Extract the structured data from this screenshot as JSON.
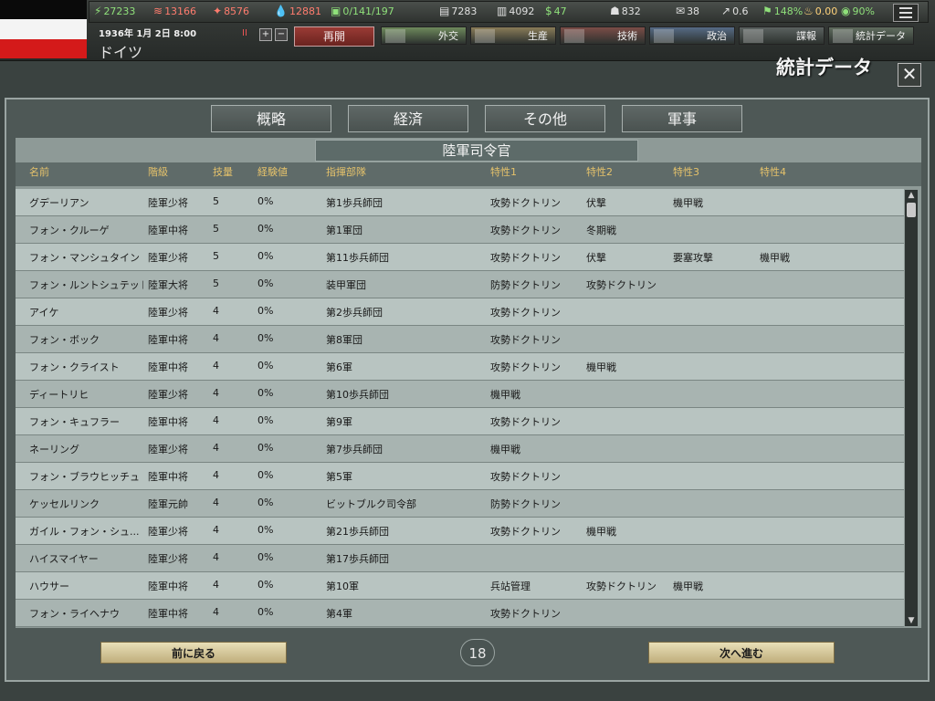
{
  "country": {
    "name": "ドイツ",
    "date": "1936年 1月 2日 8:00"
  },
  "resources": [
    {
      "icon": "energy-icon",
      "glyph": "⚡",
      "value": "27233",
      "color": "#8fe07a"
    },
    {
      "icon": "metal-icon",
      "glyph": "≋",
      "value": "13166",
      "color": "#ff7c6e"
    },
    {
      "icon": "rare-materials-icon",
      "glyph": "✦",
      "value": "8576",
      "color": "#ff7c6e"
    },
    {
      "icon": "oil-icon",
      "glyph": "💧",
      "value": "12881",
      "color": "#ff7c6e"
    },
    {
      "icon": "manpower-icon",
      "glyph": "▣",
      "value": "0/141/197",
      "color": "#8fe07a"
    },
    {
      "icon": "supplies-icon",
      "glyph": "▤",
      "value": "7283",
      "color": "#e0e0e0"
    },
    {
      "icon": "money-icon",
      "glyph": "▥",
      "value": "4092",
      "color": "#e0e0e0"
    },
    {
      "icon": "dollar-icon",
      "glyph": "$",
      "value": "47",
      "color": "#8fe07a"
    },
    {
      "icon": "soldier-icon",
      "glyph": "☗",
      "value": "832",
      "color": "#e0e0e0"
    },
    {
      "icon": "mail-icon",
      "glyph": "✉",
      "value": "38",
      "color": "#e0e0e0"
    },
    {
      "icon": "dissent-icon",
      "glyph": "↗",
      "value": "0.6",
      "color": "#e0e0e0"
    },
    {
      "icon": "national-unity-icon",
      "glyph": "⚑",
      "value": "148%",
      "color": "#8fe07a"
    },
    {
      "icon": "fuel-icon",
      "glyph": "♨",
      "value": "0.00",
      "color": "#ffd27a"
    },
    {
      "icon": "neutrality-icon",
      "glyph": "◉",
      "value": "90%",
      "color": "#8fe07a"
    }
  ],
  "controls": {
    "pause": "II",
    "plus": "+",
    "minus": "−",
    "resume": "再開"
  },
  "nav_tabs": [
    {
      "label": "外交",
      "color": "#6e8a5c"
    },
    {
      "label": "生産",
      "color": "#8a7c58"
    },
    {
      "label": "技術",
      "color": "#7b4d47"
    },
    {
      "label": "政治",
      "color": "#566b86"
    },
    {
      "label": "諜報",
      "color": "#5b6260"
    },
    {
      "label": "統計データ",
      "color": "#5f6c5e"
    }
  ],
  "panel_title": "統計データ",
  "close": "✕",
  "categories": [
    "概略",
    "経済",
    "その他",
    "軍事"
  ],
  "subtitle": "陸軍司令官",
  "columns": [
    "名前",
    "階級",
    "技量",
    "経験値",
    "指揮部隊",
    "特性1",
    "特性2",
    "特性3",
    "特性4"
  ],
  "rows": [
    [
      "グデーリアン",
      "陸軍少将",
      "5",
      "0%",
      "第1歩兵師団",
      "攻勢ドクトリン",
      "伏撃",
      "機甲戦",
      ""
    ],
    [
      "フォン・クルーゲ",
      "陸軍中将",
      "5",
      "0%",
      "第1軍団",
      "攻勢ドクトリン",
      "冬期戦",
      "",
      ""
    ],
    [
      "フォン・マンシュタイン",
      "陸軍少将",
      "5",
      "0%",
      "第11歩兵師団",
      "攻勢ドクトリン",
      "伏撃",
      "要塞攻撃",
      "機甲戦"
    ],
    [
      "フォン・ルントシュテット",
      "陸軍大将",
      "5",
      "0%",
      "装甲軍団",
      "防勢ドクトリン",
      "攻勢ドクトリン",
      "",
      ""
    ],
    [
      "アイケ",
      "陸軍少将",
      "4",
      "0%",
      "第2歩兵師団",
      "攻勢ドクトリン",
      "",
      "",
      ""
    ],
    [
      "フォン・ボック",
      "陸軍中将",
      "4",
      "0%",
      "第8軍団",
      "攻勢ドクトリン",
      "",
      "",
      ""
    ],
    [
      "フォン・クライスト",
      "陸軍中将",
      "4",
      "0%",
      "第6軍",
      "攻勢ドクトリン",
      "機甲戦",
      "",
      ""
    ],
    [
      "ディートリヒ",
      "陸軍少将",
      "4",
      "0%",
      "第10歩兵師団",
      "機甲戦",
      "",
      "",
      ""
    ],
    [
      "フォン・キュフラー",
      "陸軍中将",
      "4",
      "0%",
      "第9軍",
      "攻勢ドクトリン",
      "",
      "",
      ""
    ],
    [
      "ネーリング",
      "陸軍少将",
      "4",
      "0%",
      "第7歩兵師団",
      "機甲戦",
      "",
      "",
      ""
    ],
    [
      "フォン・ブラウヒッチュ",
      "陸軍中将",
      "4",
      "0%",
      "第5軍",
      "攻勢ドクトリン",
      "",
      "",
      ""
    ],
    [
      "ケッセルリンク",
      "陸軍元帥",
      "4",
      "0%",
      "ビットブルク司令部",
      "防勢ドクトリン",
      "",
      "",
      ""
    ],
    [
      "ガイル・フォン・シュ...",
      "陸軍少将",
      "4",
      "0%",
      "第21歩兵師団",
      "攻勢ドクトリン",
      "機甲戦",
      "",
      ""
    ],
    [
      "ハイスマイヤー",
      "陸軍少将",
      "4",
      "0%",
      "第17歩兵師団",
      "",
      "",
      "",
      ""
    ],
    [
      "ハウサー",
      "陸軍中将",
      "4",
      "0%",
      "第10軍",
      "兵站管理",
      "攻勢ドクトリン",
      "機甲戦",
      ""
    ],
    [
      "フォン・ライヘナウ",
      "陸軍中将",
      "4",
      "0%",
      "第4軍",
      "攻勢ドクトリン",
      "",
      "",
      ""
    ]
  ],
  "footer": {
    "prev": "前に戻る",
    "next": "次へ進む",
    "page": "18"
  }
}
